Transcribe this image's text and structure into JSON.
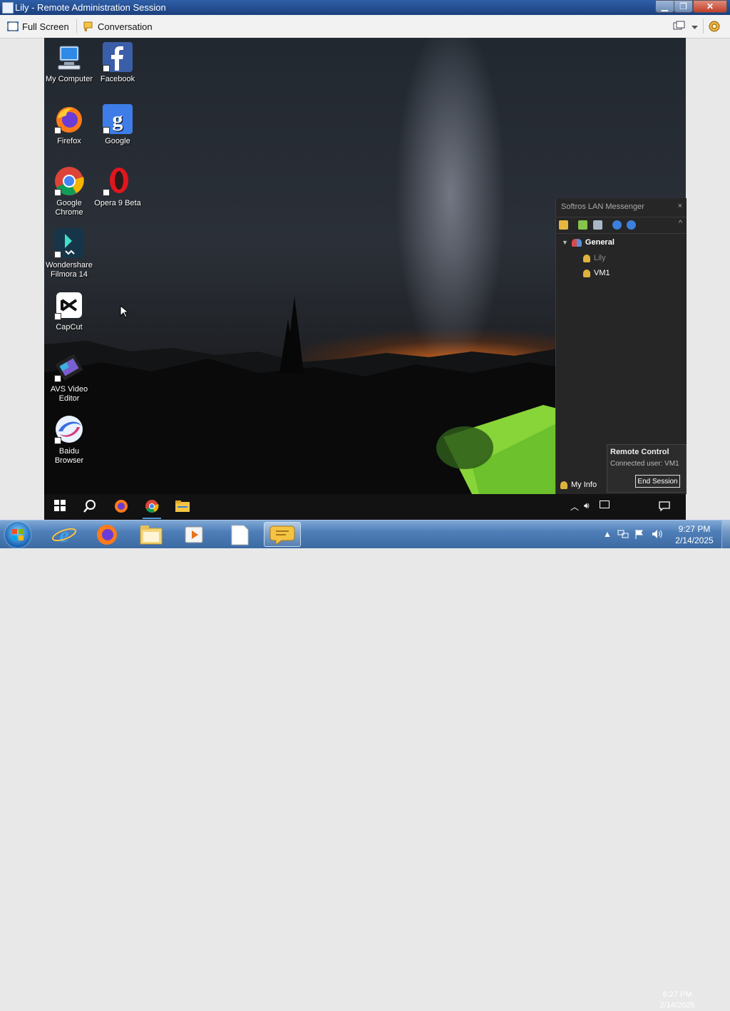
{
  "window": {
    "title": "Lily - Remote Administration Session",
    "controls": [
      "minimize-icon",
      "maximize-icon",
      "close-icon"
    ]
  },
  "toolbar": {
    "full_screen_label": "Full Screen",
    "conversation_label": "Conversation"
  },
  "desktop": {
    "icons": [
      {
        "label": "My Computer"
      },
      {
        "label": "Facebook"
      },
      {
        "label": "Firefox"
      },
      {
        "label": "Google"
      },
      {
        "label": "Google Chrome"
      },
      {
        "label": "Opera 9 Beta"
      },
      {
        "label": "Wondershare Filmora 14"
      },
      {
        "label": "CapCut"
      },
      {
        "label": "AVS Video Editor"
      },
      {
        "label": "Baidu Browser"
      }
    ]
  },
  "messenger": {
    "title": "Softros LAN Messenger",
    "close": "×",
    "group": "General",
    "users": [
      "Lily",
      "VM1"
    ],
    "my_info": "My Info"
  },
  "remote_control": {
    "title": "Remote Control",
    "status": "Connected user: VM1",
    "end_button": "End Session"
  },
  "remote_taskbar": {
    "time": "6:27 PM",
    "date": "2/14/2025"
  },
  "local_taskbar": {
    "time": "9:27 PM",
    "date": "2/14/2025"
  },
  "colors": {
    "title_bar": "#1b3f7c",
    "messenger_bg": "#262626",
    "win7_taskbar": "#4f7fb8",
    "remote_taskbar": "#121212",
    "tent_green": "#7fd13a"
  }
}
